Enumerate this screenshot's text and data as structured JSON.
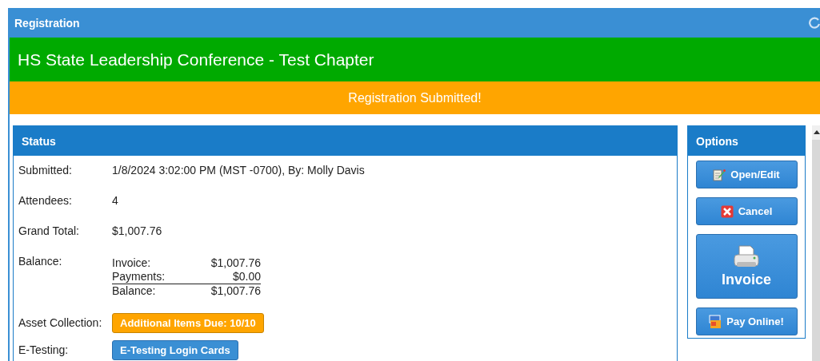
{
  "window": {
    "title": "Registration"
  },
  "event_title": "HS State Leadership Conference - Test Chapter",
  "status_banner": "Registration Submitted!",
  "status_panel": {
    "title": "Status",
    "rows": [
      {
        "kind": "text",
        "label": "Submitted:",
        "value": "1/8/2024 3:02:00 PM (MST -0700), By: Molly Davis"
      },
      {
        "kind": "text",
        "label": "Attendees:",
        "value": "4"
      },
      {
        "kind": "text",
        "label": "Grand Total:",
        "value": "$1,007.76"
      },
      {
        "kind": "balance",
        "label": "Balance:",
        "lines": [
          {
            "label": "Invoice:",
            "amount": "$1,007.76"
          },
          {
            "label": "Payments:",
            "amount": "$0.00"
          },
          {
            "label": "Balance:",
            "amount": "$1,007.76"
          }
        ]
      },
      {
        "kind": "button",
        "label": "Asset Collection:",
        "button": "Additional Items Due: 10/10",
        "color": "#ffa500"
      },
      {
        "kind": "button",
        "label": "E-Testing:",
        "button": "E-Testing Login Cards",
        "color": "#3a8fd4"
      }
    ]
  },
  "options_panel": {
    "title": "Options",
    "buttons": [
      {
        "kind": "edit",
        "label": "Open/Edit"
      },
      {
        "kind": "cancel",
        "label": "Cancel"
      },
      {
        "kind": "print",
        "label": "Invoice"
      },
      {
        "kind": "pay",
        "label": "Pay Online!"
      }
    ]
  }
}
